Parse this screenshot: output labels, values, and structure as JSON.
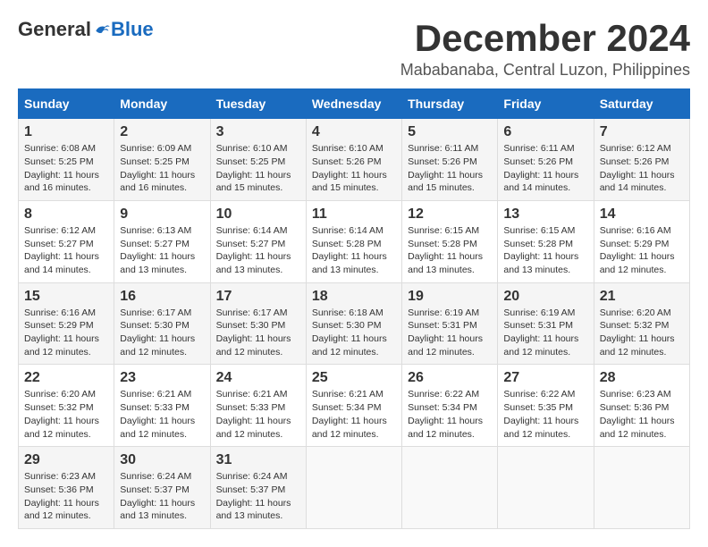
{
  "header": {
    "logo_general": "General",
    "logo_blue": "Blue",
    "month_title": "December 2024",
    "location": "Mababanaba, Central Luzon, Philippines"
  },
  "calendar": {
    "days_of_week": [
      "Sunday",
      "Monday",
      "Tuesday",
      "Wednesday",
      "Thursday",
      "Friday",
      "Saturday"
    ],
    "weeks": [
      [
        {
          "day": "",
          "empty": true
        },
        {
          "day": "",
          "empty": true
        },
        {
          "day": "",
          "empty": true
        },
        {
          "day": "",
          "empty": true
        },
        {
          "day": "",
          "empty": true
        },
        {
          "day": "",
          "empty": true
        },
        {
          "day": "",
          "empty": true
        }
      ],
      [
        {
          "day": "1",
          "sunrise": "6:08 AM",
          "sunset": "5:25 PM",
          "daylight": "11 hours and 16 minutes."
        },
        {
          "day": "2",
          "sunrise": "6:09 AM",
          "sunset": "5:25 PM",
          "daylight": "11 hours and 16 minutes."
        },
        {
          "day": "3",
          "sunrise": "6:10 AM",
          "sunset": "5:25 PM",
          "daylight": "11 hours and 15 minutes."
        },
        {
          "day": "4",
          "sunrise": "6:10 AM",
          "sunset": "5:26 PM",
          "daylight": "11 hours and 15 minutes."
        },
        {
          "day": "5",
          "sunrise": "6:11 AM",
          "sunset": "5:26 PM",
          "daylight": "11 hours and 15 minutes."
        },
        {
          "day": "6",
          "sunrise": "6:11 AM",
          "sunset": "5:26 PM",
          "daylight": "11 hours and 14 minutes."
        },
        {
          "day": "7",
          "sunrise": "6:12 AM",
          "sunset": "5:26 PM",
          "daylight": "11 hours and 14 minutes."
        }
      ],
      [
        {
          "day": "8",
          "sunrise": "6:12 AM",
          "sunset": "5:27 PM",
          "daylight": "11 hours and 14 minutes."
        },
        {
          "day": "9",
          "sunrise": "6:13 AM",
          "sunset": "5:27 PM",
          "daylight": "11 hours and 13 minutes."
        },
        {
          "day": "10",
          "sunrise": "6:14 AM",
          "sunset": "5:27 PM",
          "daylight": "11 hours and 13 minutes."
        },
        {
          "day": "11",
          "sunrise": "6:14 AM",
          "sunset": "5:28 PM",
          "daylight": "11 hours and 13 minutes."
        },
        {
          "day": "12",
          "sunrise": "6:15 AM",
          "sunset": "5:28 PM",
          "daylight": "11 hours and 13 minutes."
        },
        {
          "day": "13",
          "sunrise": "6:15 AM",
          "sunset": "5:28 PM",
          "daylight": "11 hours and 13 minutes."
        },
        {
          "day": "14",
          "sunrise": "6:16 AM",
          "sunset": "5:29 PM",
          "daylight": "11 hours and 12 minutes."
        }
      ],
      [
        {
          "day": "15",
          "sunrise": "6:16 AM",
          "sunset": "5:29 PM",
          "daylight": "11 hours and 12 minutes."
        },
        {
          "day": "16",
          "sunrise": "6:17 AM",
          "sunset": "5:30 PM",
          "daylight": "11 hours and 12 minutes."
        },
        {
          "day": "17",
          "sunrise": "6:17 AM",
          "sunset": "5:30 PM",
          "daylight": "11 hours and 12 minutes."
        },
        {
          "day": "18",
          "sunrise": "6:18 AM",
          "sunset": "5:30 PM",
          "daylight": "11 hours and 12 minutes."
        },
        {
          "day": "19",
          "sunrise": "6:19 AM",
          "sunset": "5:31 PM",
          "daylight": "11 hours and 12 minutes."
        },
        {
          "day": "20",
          "sunrise": "6:19 AM",
          "sunset": "5:31 PM",
          "daylight": "11 hours and 12 minutes."
        },
        {
          "day": "21",
          "sunrise": "6:20 AM",
          "sunset": "5:32 PM",
          "daylight": "11 hours and 12 minutes."
        }
      ],
      [
        {
          "day": "22",
          "sunrise": "6:20 AM",
          "sunset": "5:32 PM",
          "daylight": "11 hours and 12 minutes."
        },
        {
          "day": "23",
          "sunrise": "6:21 AM",
          "sunset": "5:33 PM",
          "daylight": "11 hours and 12 minutes."
        },
        {
          "day": "24",
          "sunrise": "6:21 AM",
          "sunset": "5:33 PM",
          "daylight": "11 hours and 12 minutes."
        },
        {
          "day": "25",
          "sunrise": "6:21 AM",
          "sunset": "5:34 PM",
          "daylight": "11 hours and 12 minutes."
        },
        {
          "day": "26",
          "sunrise": "6:22 AM",
          "sunset": "5:34 PM",
          "daylight": "11 hours and 12 minutes."
        },
        {
          "day": "27",
          "sunrise": "6:22 AM",
          "sunset": "5:35 PM",
          "daylight": "11 hours and 12 minutes."
        },
        {
          "day": "28",
          "sunrise": "6:23 AM",
          "sunset": "5:36 PM",
          "daylight": "11 hours and 12 minutes."
        }
      ],
      [
        {
          "day": "29",
          "sunrise": "6:23 AM",
          "sunset": "5:36 PM",
          "daylight": "11 hours and 12 minutes."
        },
        {
          "day": "30",
          "sunrise": "6:24 AM",
          "sunset": "5:37 PM",
          "daylight": "11 hours and 13 minutes."
        },
        {
          "day": "31",
          "sunrise": "6:24 AM",
          "sunset": "5:37 PM",
          "daylight": "11 hours and 13 minutes."
        },
        {
          "day": "",
          "empty": true
        },
        {
          "day": "",
          "empty": true
        },
        {
          "day": "",
          "empty": true
        },
        {
          "day": "",
          "empty": true
        }
      ]
    ]
  }
}
